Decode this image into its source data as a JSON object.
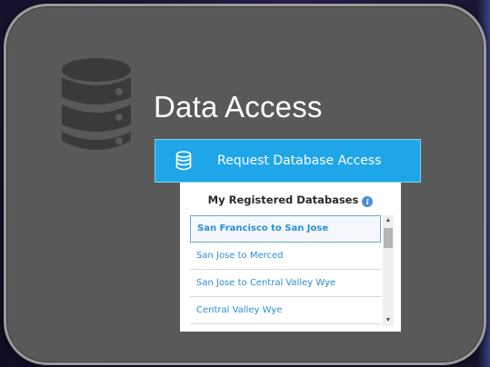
{
  "card": {
    "title": "Data Access"
  },
  "request_button": {
    "label": "Request Database Access",
    "icon": "database-icon"
  },
  "registered_panel": {
    "header": "My Registered Databases",
    "info_icon": "info-icon",
    "items": [
      {
        "label": "San Francisco to San Jose",
        "selected": true
      },
      {
        "label": "San Jose to Merced",
        "selected": false
      },
      {
        "label": "San Jose to Central Valley Wye",
        "selected": false
      },
      {
        "label": "Central Valley Wye",
        "selected": false
      }
    ]
  },
  "colors": {
    "card_bg": "#595959",
    "accent": "#1fa6e9",
    "link": "#2a8fd4"
  }
}
